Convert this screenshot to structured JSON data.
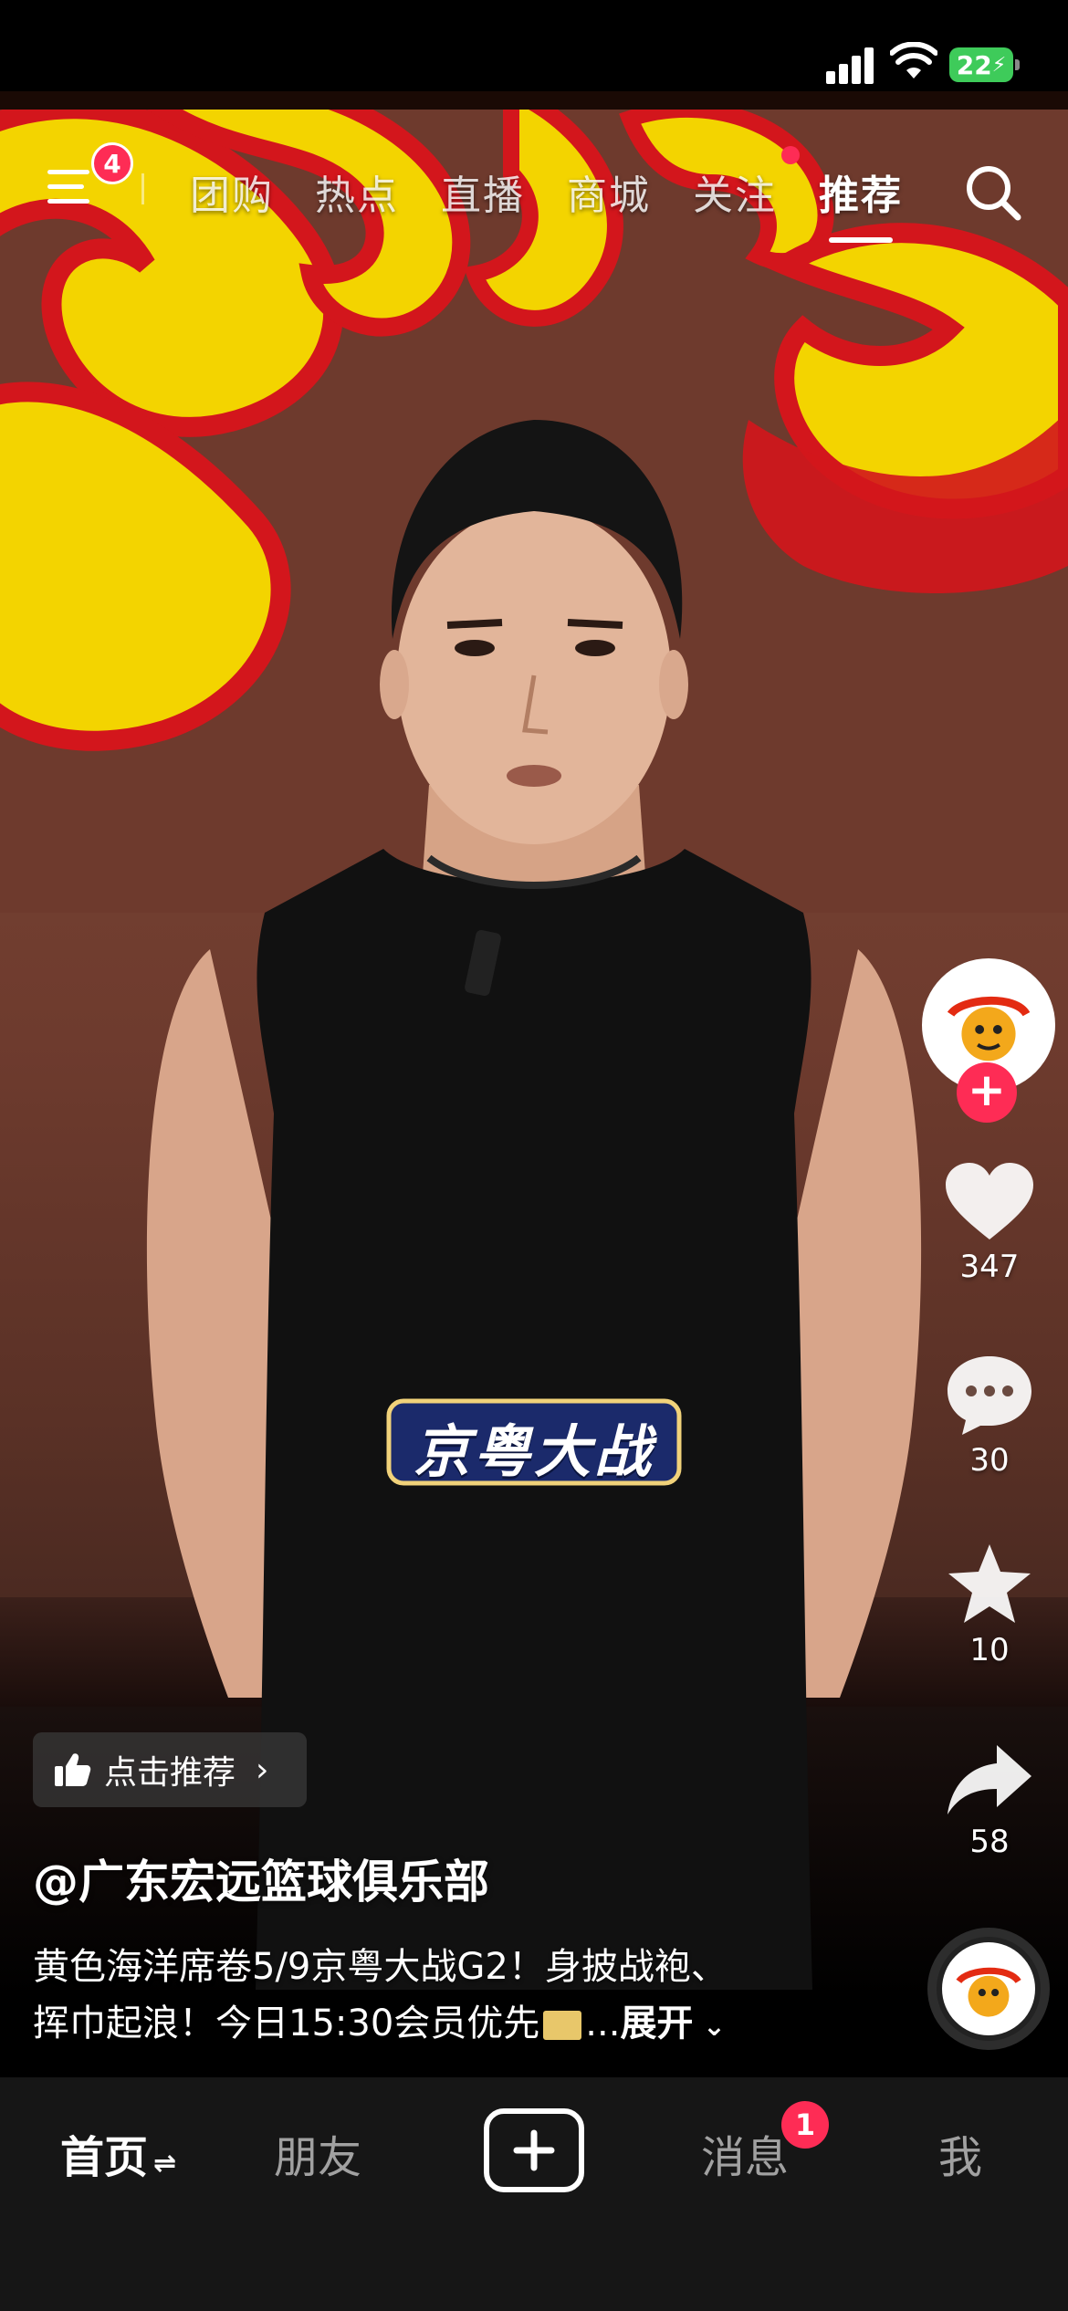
{
  "status_bar": {
    "battery": "22"
  },
  "top_nav": {
    "menu_badge": "4",
    "tabs": [
      {
        "label": "团购"
      },
      {
        "label": "热点"
      },
      {
        "label": "直播"
      },
      {
        "label": "商城"
      },
      {
        "label": "关注"
      },
      {
        "label": "推荐"
      }
    ],
    "active_tab": "推荐"
  },
  "video": {
    "overlay_title": "京粤大战"
  },
  "actions": {
    "likes": "347",
    "comments": "30",
    "favorites": "10",
    "shares": "58",
    "follow_symbol": "+"
  },
  "caption": {
    "recommend_label": "点击推荐",
    "author": "@广东宏远篮球俱乐部",
    "desc_line1": "黄色海洋席卷5/9京粤大战G2！身披战袍、",
    "desc_line2": "挥巾起浪！今日15:30会员优先",
    "ellipsis": "...",
    "expand_label": "展开"
  },
  "bottom_nav": {
    "home": "首页",
    "friends": "朋友",
    "messages": "消息",
    "messages_badge": "1",
    "me": "我"
  },
  "colors": {
    "accent": "#fe2c55",
    "flame_yellow": "#f3d400",
    "flame_red": "#d3161c",
    "nav_bg": "#161616"
  }
}
